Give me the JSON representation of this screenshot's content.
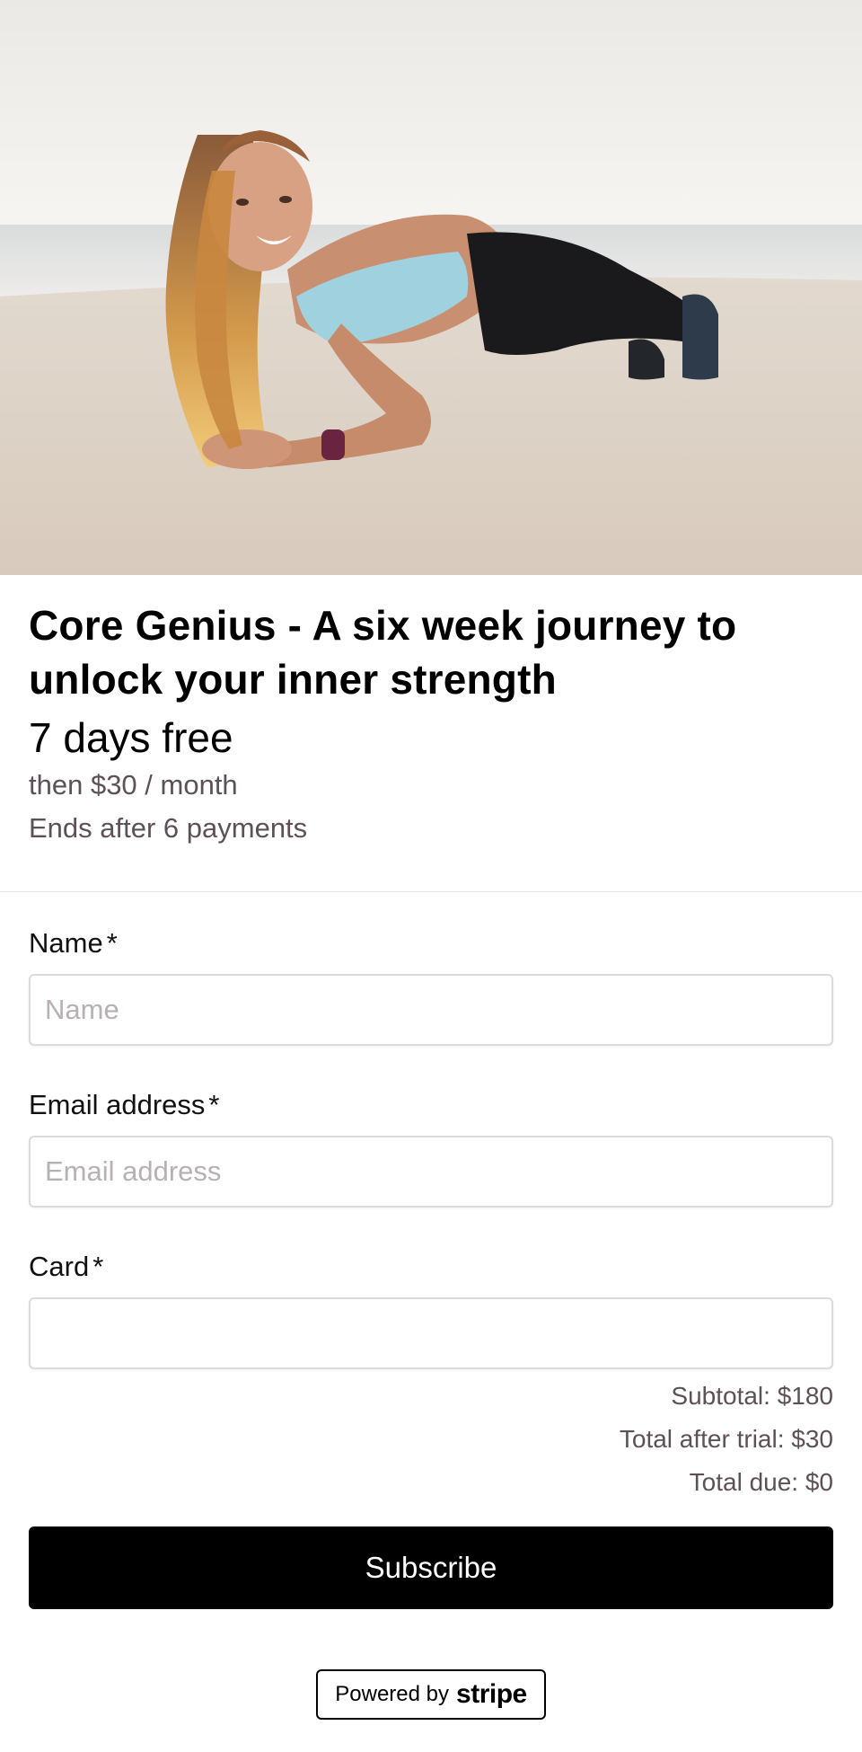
{
  "hero_image": {
    "alt": "Woman holding a plank on the beach"
  },
  "product": {
    "title": "Core Genius - A six week journey to unlock your inner strength",
    "trial": "7 days free",
    "recurring": "then $30 / month",
    "duration": "Ends after 6 payments"
  },
  "form": {
    "name": {
      "label": "Name",
      "required_mark": "*",
      "placeholder": "Name",
      "value": ""
    },
    "email": {
      "label": "Email address",
      "required_mark": "*",
      "placeholder": "Email address",
      "value": ""
    },
    "card": {
      "label": "Card",
      "required_mark": "*",
      "placeholder": "",
      "value": ""
    }
  },
  "totals": {
    "subtotal": "Subtotal: $180",
    "after_trial": "Total after trial: $30",
    "due": "Total due: $0"
  },
  "subscribe_label": "Subscribe",
  "footer": {
    "powered_by": "Powered by",
    "brand": "stripe"
  },
  "colors": {
    "button_bg": "#000000",
    "button_text": "#ffffff",
    "muted_text": "#5e5057",
    "input_border": "#dcdcdc"
  }
}
